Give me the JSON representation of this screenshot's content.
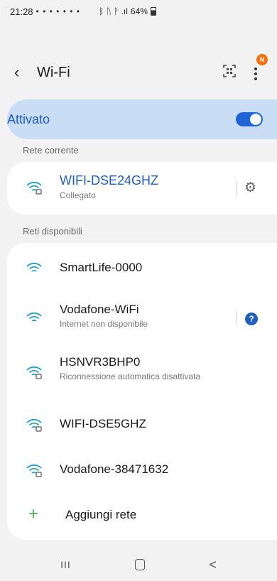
{
  "status_bar": {
    "time": "21:28",
    "notification_icons": "• • • • • • •",
    "signal_text": "ᛒ ᚢ ᚹ .ıl",
    "battery": "64%"
  },
  "app_bar": {
    "title": "Wi-Fi",
    "back_icon": "‹",
    "qr_icon": "⌘",
    "badge": "N"
  },
  "toggle": {
    "label": "Attivato",
    "state": "on"
  },
  "current_network": {
    "section_label": "Rete corrente",
    "name": "WIFI-DSE24GHZ",
    "status": "Collegato",
    "settings_icon": "⚙"
  },
  "available_networks": {
    "section_label": "Reti disponibili",
    "items": [
      {
        "name": "SmartLife-0000",
        "sub": "",
        "locked": false
      },
      {
        "name": "Vodafone-WiFi",
        "sub": "Internet non disponibile",
        "locked": false,
        "help": "?"
      },
      {
        "name": "HSNVR3BHP0",
        "sub": "Riconnessione automatica disattivata",
        "locked": true
      },
      {
        "name": "WIFI-DSE5GHZ",
        "sub": "",
        "locked": true
      },
      {
        "name": "Vodafone-38471632",
        "sub": "",
        "locked": true
      }
    ],
    "add_label": "Aggiungi rete",
    "add_icon": "+"
  },
  "nav_bar": {
    "recent": "III",
    "back": "<"
  },
  "colors": {
    "accent": "#1f5dbf",
    "toggle_bg": "#c9ddf5",
    "wifi_icon": "#22a0c8"
  }
}
